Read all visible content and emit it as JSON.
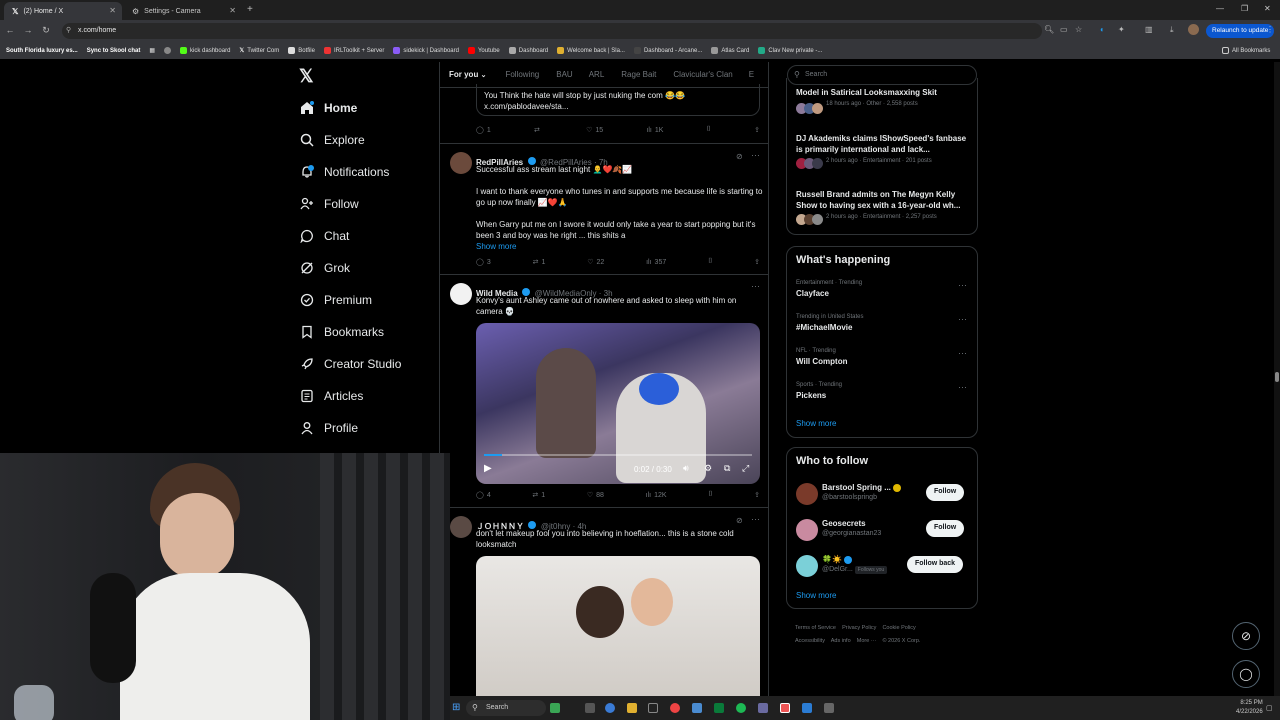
{
  "browser": {
    "tabs": [
      {
        "label": "(2) Home / X",
        "active": true
      },
      {
        "label": "Settings - Camera",
        "active": false
      }
    ],
    "url": "x.com/home",
    "relaunch_label": "Relaunch to update",
    "bookmarks": [
      "South Florida luxury es...",
      "Sync to Skool chat",
      "kick dashboard",
      "Twitter Com",
      "Botfile",
      "IRLToolkit + Server",
      "sidekick | Dashboard",
      "Youtube",
      "Dashboard",
      "Welcome back | Sla...",
      "Dashboard - Arcane...",
      "Atlas Card",
      "Clav New private -..."
    ],
    "all_bookmarks": "All Bookmarks"
  },
  "nav": {
    "items": [
      "Home",
      "Explore",
      "Notifications",
      "Follow",
      "Chat",
      "Grok",
      "Premium",
      "Bookmarks",
      "Creator Studio",
      "Articles",
      "Profile"
    ]
  },
  "feed": {
    "tabs": [
      "For you",
      "Following",
      "BAU",
      "ARL",
      "Rage Bait",
      "Clavicular's Clan",
      "E"
    ],
    "quoted_text": "You Think the hate will stop by just nuking the com 😂😂",
    "quoted_link": "x.com/pablodavee/sta...",
    "post0_actions": {
      "replies": "1",
      "reposts": "",
      "likes": "15",
      "views": "1K"
    },
    "posts": [
      {
        "name": "RedPillAries",
        "handle": "@RedPillAries · 7h",
        "line1": "Successful ass stream last night 👨‍🦲❤️🍂📈",
        "line2": "I want to thank everyone who tunes in and supports me because life is starting to go up now finally 📈❤️🙏",
        "line3": "When Garry put me on I swore it would only take a year to start popping but it's been 3 and boy was he right ... this shits a",
        "show_more": "Show more",
        "replies": "3",
        "reposts": "1",
        "likes": "22",
        "views": "357"
      },
      {
        "name": "Wild Media",
        "handle": "@WildMediaOnly · 3h",
        "line1": "Konvy's aunt Ashley came out of nowhere and asked to sleep with him on camera 💀",
        "video_time": "0:02 / 0:30",
        "video_progress": 0.067,
        "replies": "4",
        "reposts": "1",
        "likes": "88",
        "views": "12K"
      },
      {
        "name": "ＪＯＨＮＮＹ",
        "handle": "@jt0hny · 4h",
        "line1": "don't let makeup fool you into believing in hoeflation... this is a stone cold looksmatch"
      }
    ]
  },
  "right": {
    "search_placeholder": "Search",
    "news": [
      {
        "title": "Model in Satirical Looksmaxxing Skit",
        "meta": "18 hours ago · Other · 2,558 posts"
      },
      {
        "title": "DJ Akademiks claims IShowSpeed's fanbase is primarily international and lack...",
        "meta": "2 hours ago · Entertainment · 201 posts"
      },
      {
        "title": "Russell Brand admits on The Megyn Kelly Show to having sex with a 16-year-old wh...",
        "meta": "2 hours ago · Entertainment · 2,257 posts"
      }
    ],
    "happening_title": "What's happening",
    "trends": [
      {
        "category": "Entertainment · Trending",
        "name": "Clayface"
      },
      {
        "category": "Trending in United States",
        "name": "#MichaelMovie"
      },
      {
        "category": "NFL · Trending",
        "name": "Will Compton"
      },
      {
        "category": "Sports · Trending",
        "name": "Pickens"
      }
    ],
    "show_more": "Show more",
    "who_title": "Who to follow",
    "who": [
      {
        "name": "Barstool Spring ...",
        "handle": "@barstoolspringb",
        "button": "Follow",
        "avatar_color": "#7a3a2a"
      },
      {
        "name": "Geosecrets",
        "handle": "@georgianastan23",
        "button": "Follow",
        "avatar_color": "#c98aa0"
      },
      {
        "name": "🍀☀️",
        "handle": "@DelGr...",
        "follows_you": "Follows you",
        "button": "Follow back",
        "avatar_color": "#7bd0d8"
      }
    ],
    "who_show_more": "Show more",
    "footer": [
      "Terms of Service",
      "Privacy Policy",
      "Cookie Policy",
      "Accessibility",
      "Ads info",
      "More ···",
      "© 2026 X Corp."
    ]
  },
  "taskbar": {
    "search_placeholder": "Search",
    "time": "8:25 PM",
    "date": "4/22/2026"
  }
}
